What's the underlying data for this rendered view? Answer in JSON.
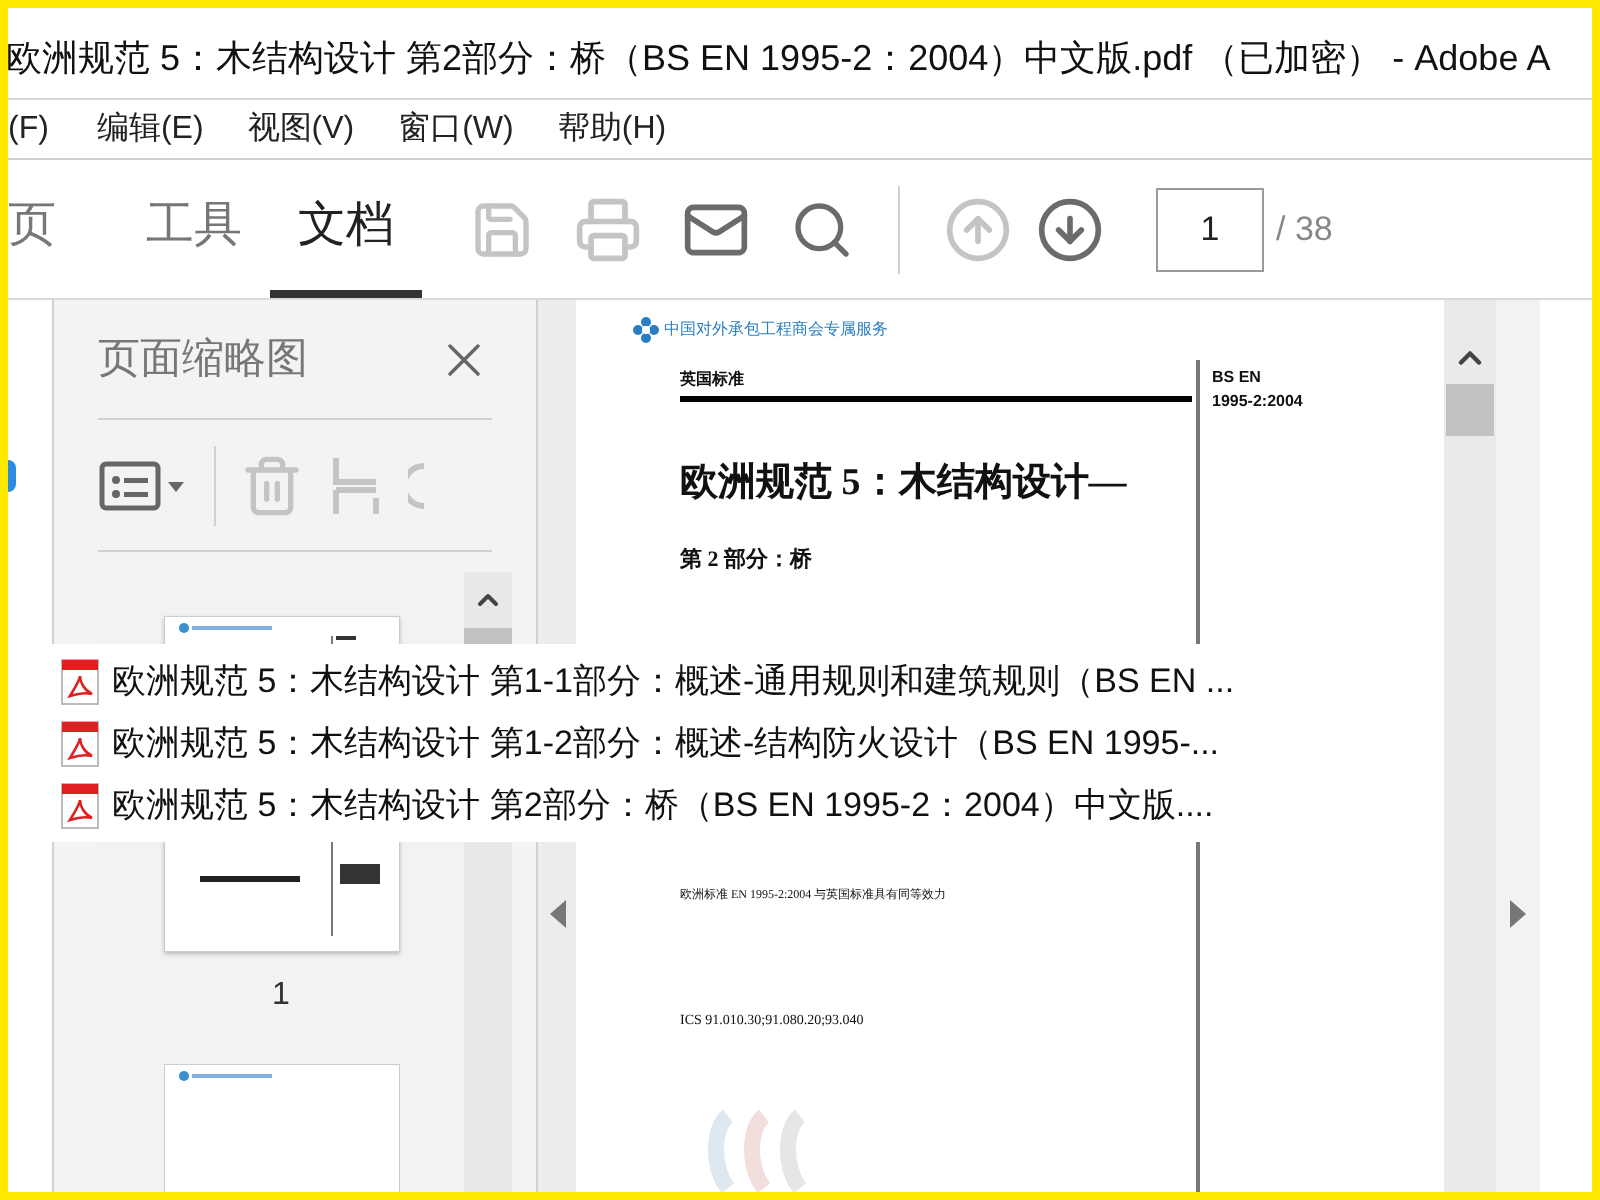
{
  "window": {
    "title": "欧洲规范 5：木结构设计 第2部分：桥（BS EN 1995-2：2004）中文版.pdf （已加密） - Adobe A"
  },
  "menu": [
    "(F)",
    "编辑(E)",
    "视图(V)",
    "窗口(W)",
    "帮助(H)"
  ],
  "tabs": [
    {
      "label": "页",
      "selected": false
    },
    {
      "label": "工具",
      "selected": false
    },
    {
      "label": "文档",
      "selected": true
    }
  ],
  "toolbar": {
    "save_disabled": true,
    "print_disabled": true,
    "prev_disabled": true,
    "next_disabled": false,
    "page": "1",
    "total": "/ 38"
  },
  "sidebar": {
    "title": "页面缩略图",
    "thumbnails": [
      "1"
    ]
  },
  "document": {
    "header": "中国对外承包工程商会专属服务",
    "label": "英国标准",
    "code": "BS EN",
    "code_number": "1995-2:2004",
    "title": "欧洲规范 5：木结构设计—",
    "part": "第 2 部分：桥",
    "equivalence": "欧洲标准 EN 1995-2:2004 与英国标准具有同等效力",
    "ics": "ICS 91.010.30;91.080.20;93.040"
  },
  "popup": [
    "欧洲规范 5：木结构设计 第1-1部分：概述-通用规则和建筑规则（BS EN ...",
    "欧洲规范 5：木结构设计 第1-2部分：概述-结构防火设计（BS EN 1995-...",
    "欧洲规范 5：木结构设计 第2部分：桥（BS EN 1995-2：2004）中文版...."
  ]
}
